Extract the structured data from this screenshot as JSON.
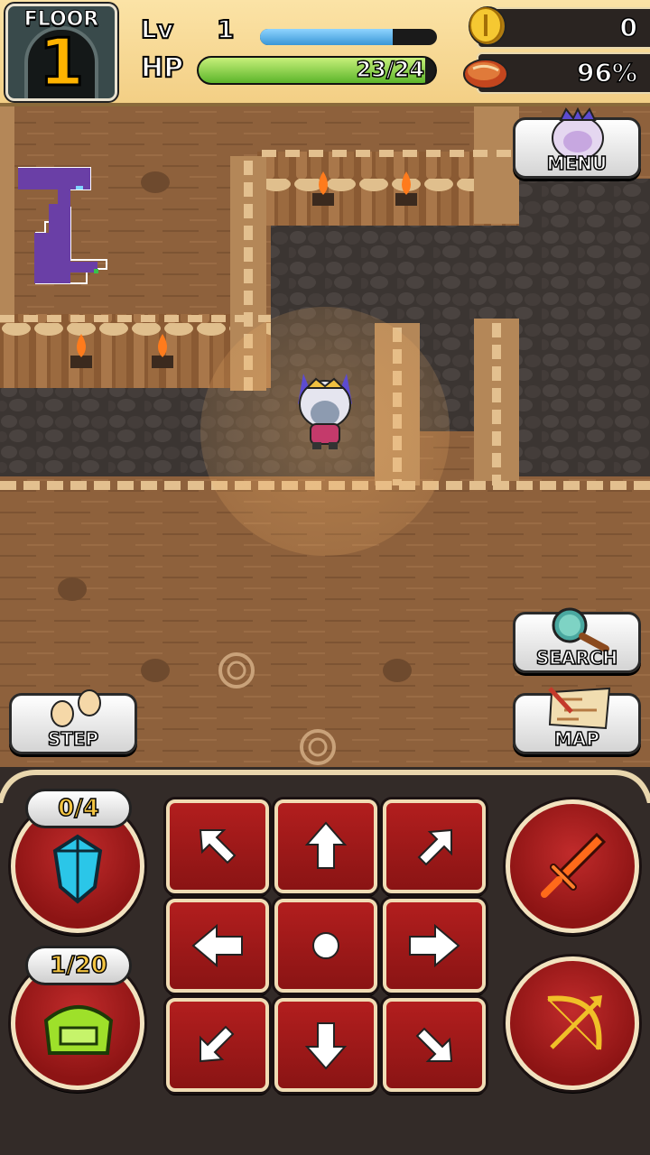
{
  "hud": {
    "floor_label": "FLOOR",
    "floor_number": "1",
    "level_label": "Lv",
    "level_value": "1",
    "exp_fraction": 0.75,
    "hp_label": "HP",
    "hp_text": "23/24",
    "hp_current": 23,
    "hp_max": 24,
    "gold": "0",
    "hunger": "96%"
  },
  "buttons": {
    "menu": "MENU",
    "search": "SEARCH",
    "step": "STEP",
    "map": "MAP"
  },
  "inventory": {
    "crystal_count": "0/4",
    "bag_count": "1/20"
  },
  "icons": {
    "coin": "coin-icon",
    "hunger": "meat-icon",
    "menu": "character-portrait-icon",
    "search": "magnifier-icon",
    "step": "footprints-icon",
    "map": "scroll-map-icon",
    "crystal": "crystal-icon",
    "bag": "backpack-icon",
    "attack": "sword-icon",
    "shoot": "bow-icon"
  },
  "colors": {
    "hp": "#5cb52a",
    "exp": "#3a97d6",
    "action_red": "#a31a1a",
    "floor_number": "#ffb300",
    "count_text": "#f4c542"
  }
}
